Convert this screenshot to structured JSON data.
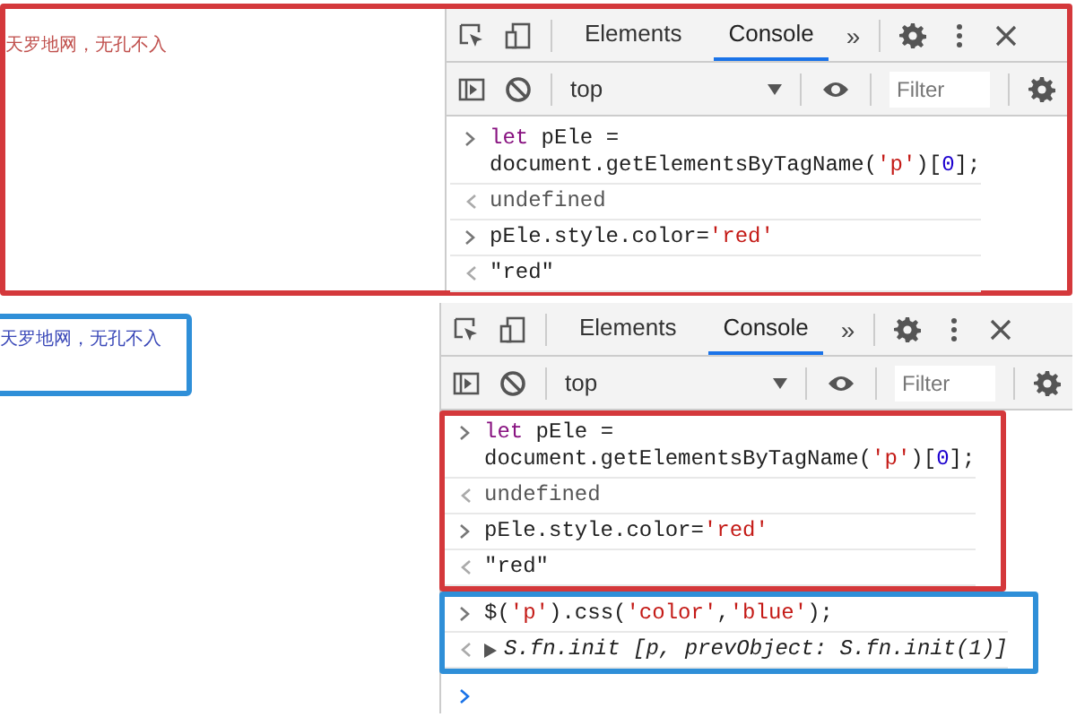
{
  "panels": [
    {
      "color": "#d4383b",
      "page": {
        "text": "天罗地网，无孔不入",
        "color": "#c0504d"
      },
      "devtools": {
        "tabs": [
          {
            "label": "Elements",
            "selected": false
          },
          {
            "label": "Console",
            "selected": true
          }
        ],
        "more": "»",
        "context": "top",
        "filter": {
          "placeholder": "Filter"
        },
        "groups": [
          {
            "entries": [
              {
                "kind": "input",
                "lines": [
                  [
                    {
                      "text": "let",
                      "kind": "keyword"
                    },
                    {
                      "text": " pEle =",
                      "kind": "plain"
                    }
                  ],
                  [
                    {
                      "text": "document.getElementsByTagName(",
                      "kind": "plain"
                    },
                    {
                      "text": "'p'",
                      "kind": "string"
                    },
                    {
                      "text": ")[",
                      "kind": "plain"
                    },
                    {
                      "text": "0",
                      "kind": "number"
                    },
                    {
                      "text": "];",
                      "kind": "plain"
                    }
                  ]
                ]
              },
              {
                "kind": "result",
                "text": "undefined"
              },
              {
                "kind": "input",
                "lines": [
                  [
                    {
                      "text": "pEle.style.color=",
                      "kind": "plain"
                    },
                    {
                      "text": "'red'",
                      "kind": "string"
                    }
                  ]
                ]
              },
              {
                "kind": "value",
                "text": "\"red\""
              }
            ]
          }
        ]
      }
    },
    {
      "page": {
        "text": "天罗地网，无孔不入",
        "color": "#3a48b8",
        "frame": {
          "color": "#2f8fd8"
        }
      },
      "devtools": {
        "tabs": [
          {
            "label": "Elements",
            "selected": false
          },
          {
            "label": "Console",
            "selected": true
          }
        ],
        "more": "»",
        "context": "top",
        "filter": {
          "placeholder": "Filter"
        },
        "groups": [
          {
            "color": "#d4383b",
            "entries": [
              {
                "kind": "input",
                "lines": [
                  [
                    {
                      "text": "let",
                      "kind": "keyword"
                    },
                    {
                      "text": " pEle =",
                      "kind": "plain"
                    }
                  ],
                  [
                    {
                      "text": "document.getElementsByTagName(",
                      "kind": "plain"
                    },
                    {
                      "text": "'p'",
                      "kind": "string"
                    },
                    {
                      "text": ")[",
                      "kind": "plain"
                    },
                    {
                      "text": "0",
                      "kind": "number"
                    },
                    {
                      "text": "];",
                      "kind": "plain"
                    }
                  ]
                ]
              },
              {
                "kind": "result",
                "text": "undefined"
              },
              {
                "kind": "input",
                "lines": [
                  [
                    {
                      "text": "pEle.style.color=",
                      "kind": "plain"
                    },
                    {
                      "text": "'red'",
                      "kind": "string"
                    }
                  ]
                ]
              },
              {
                "kind": "value",
                "text": "\"red\""
              }
            ]
          },
          {
            "color": "#2f8fd8",
            "entries": [
              {
                "kind": "input",
                "lines": [
                  [
                    {
                      "text": "$(",
                      "kind": "plain"
                    },
                    {
                      "text": "'p'",
                      "kind": "string"
                    },
                    {
                      "text": ").css(",
                      "kind": "plain"
                    },
                    {
                      "text": "'color'",
                      "kind": "string"
                    },
                    {
                      "text": ",",
                      "kind": "plain"
                    },
                    {
                      "text": "'blue'",
                      "kind": "string"
                    },
                    {
                      "text": ");",
                      "kind": "plain"
                    }
                  ]
                ]
              },
              {
                "kind": "object",
                "text": "S.fn.init [p, prevObject: S.fn.init(1)]"
              }
            ]
          },
          {
            "entries": [
              {
                "kind": "prompt"
              }
            ]
          }
        ]
      }
    }
  ]
}
